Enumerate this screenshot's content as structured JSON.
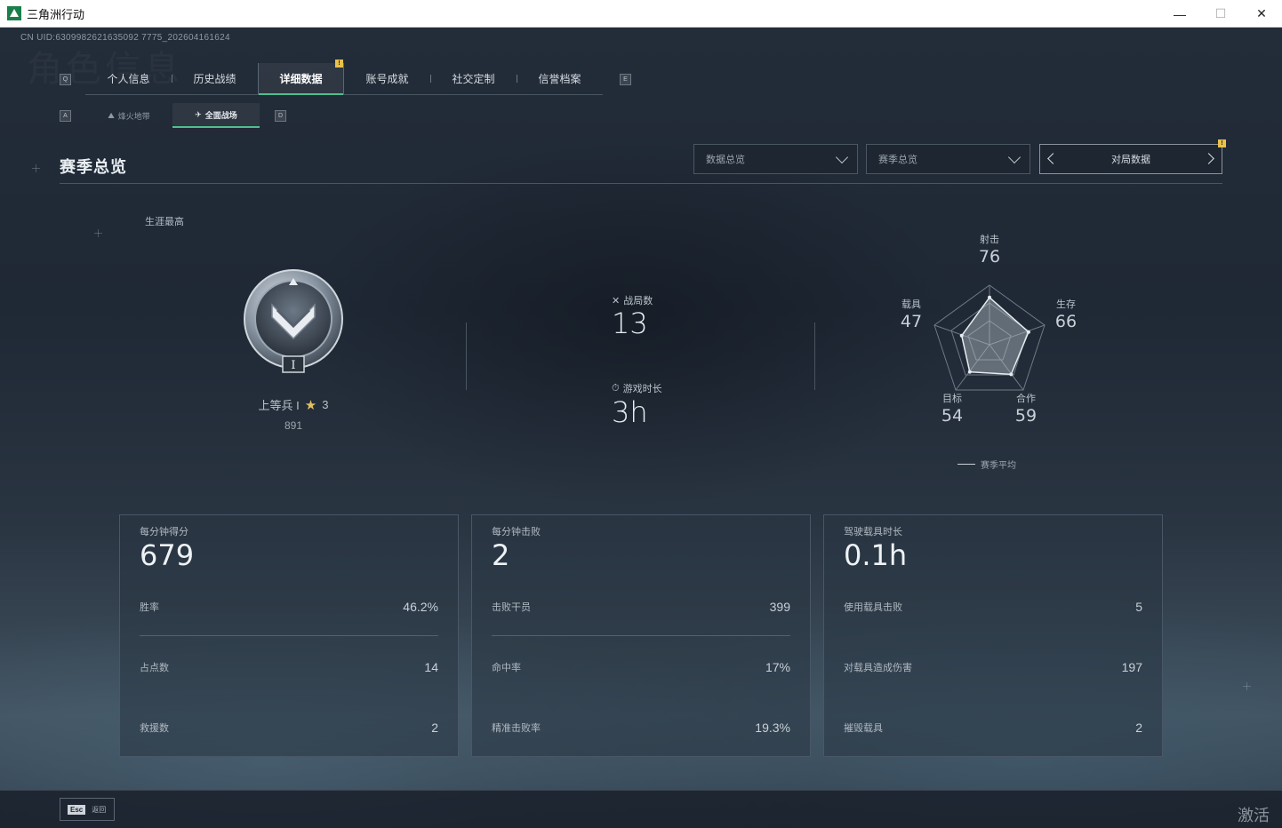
{
  "window": {
    "title": "三角洲行动",
    "minimize": "—",
    "maximize": "☐",
    "close": "✕"
  },
  "uid": "CN UID:6309982621635092 7775_202604161624",
  "ghost_title": "角色信息",
  "tabs": {
    "key_left": "Q",
    "key_right": "E",
    "items": [
      {
        "label": "个人信息"
      },
      {
        "label": "历史战绩"
      },
      {
        "label": "详细数据"
      },
      {
        "label": "账号成就"
      },
      {
        "label": "社交定制"
      },
      {
        "label": "信誉档案"
      }
    ],
    "new_badge": "!"
  },
  "subtabs": {
    "key_left": "A",
    "key_right": "D",
    "items": [
      {
        "label": "烽火地带",
        "icon": "fire-zone-icon"
      },
      {
        "label": "全面战场",
        "icon": "battlefield-icon"
      }
    ]
  },
  "section": {
    "title": "赛季总览",
    "select1": "数据总览",
    "select2": "赛季总览",
    "pager_label": "对局数据",
    "pager_badge": "!"
  },
  "rank": {
    "career_label": "生涯最高",
    "rank_name": "上等兵 I",
    "stars": "3",
    "score": "891",
    "medal_numeral": "I"
  },
  "middle": {
    "matches_label": "战局数",
    "matches_value": "13",
    "time_label": "游戏时长",
    "time_value": "3h"
  },
  "radar": {
    "labels": [
      "射击",
      "生存",
      "合作",
      "目标",
      "载具"
    ],
    "values": [
      "76",
      "66",
      "59",
      "54",
      "47"
    ],
    "legend": "赛季平均"
  },
  "cards": [
    {
      "head_label": "每分钟得分",
      "head_value": "679",
      "rows": [
        {
          "k": "胜率",
          "v": "46.2%"
        },
        {
          "k": "占点数",
          "v": "14"
        },
        {
          "k": "救援数",
          "v": "2"
        }
      ]
    },
    {
      "head_label": "每分钟击败",
      "head_value": "2",
      "rows": [
        {
          "k": "击败干员",
          "v": "399"
        },
        {
          "k": "命中率",
          "v": "17%"
        },
        {
          "k": "精准击败率",
          "v": "19.3%"
        }
      ]
    },
    {
      "head_label": "驾驶载具时长",
      "head_value": "0.1h",
      "rows": [
        {
          "k": "使用载具击败",
          "v": "5"
        },
        {
          "k": "对载具造成伤害",
          "v": "197"
        },
        {
          "k": "摧毁载具",
          "v": "2"
        }
      ]
    }
  ],
  "bottom": {
    "esc_key": "Esc",
    "esc_label": "返回",
    "activate_text": "激活"
  }
}
